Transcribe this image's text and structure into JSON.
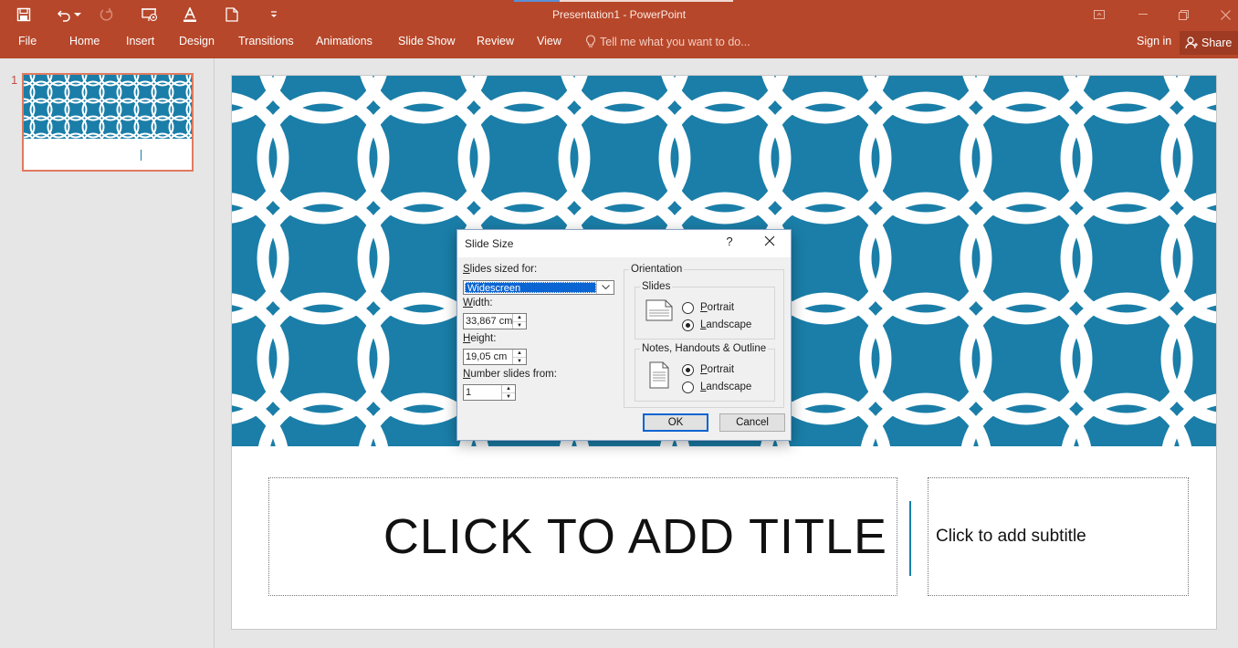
{
  "window": {
    "title": "Presentation1 - PowerPoint"
  },
  "ribbon": {
    "file": "File",
    "tabs": [
      "Home",
      "Insert",
      "Design",
      "Transitions",
      "Animations",
      "Slide Show",
      "Review",
      "View"
    ],
    "tell_me": "Tell me what you want to do...",
    "sign_in": "Sign in",
    "share": "Share"
  },
  "thumbnails": {
    "slide_number": "1"
  },
  "slide": {
    "title_placeholder": "CLICK TO ADD TITLE",
    "subtitle_placeholder": "Click to add subtitle",
    "pattern_color": "#1a7ea8"
  },
  "dialog": {
    "title": "Slide Size",
    "help": "?",
    "slides_sized_for_label": "Slides sized for:",
    "slides_sized_for_value": "Widescreen",
    "width_label": "Width:",
    "width_value": "33,867 cm",
    "height_label": "Height:",
    "height_value": "19,05 cm",
    "number_from_label": "Number slides from:",
    "number_from_value": "1",
    "orientation_label": "Orientation",
    "slides_group_label": "Slides",
    "slides_portrait": "Portrait",
    "slides_landscape": "Landscape",
    "slides_selected": "Landscape",
    "notes_group_label": "Notes, Handouts & Outline",
    "notes_portrait": "Portrait",
    "notes_landscape": "Landscape",
    "notes_selected": "Portrait",
    "ok": "OK",
    "cancel": "Cancel"
  }
}
